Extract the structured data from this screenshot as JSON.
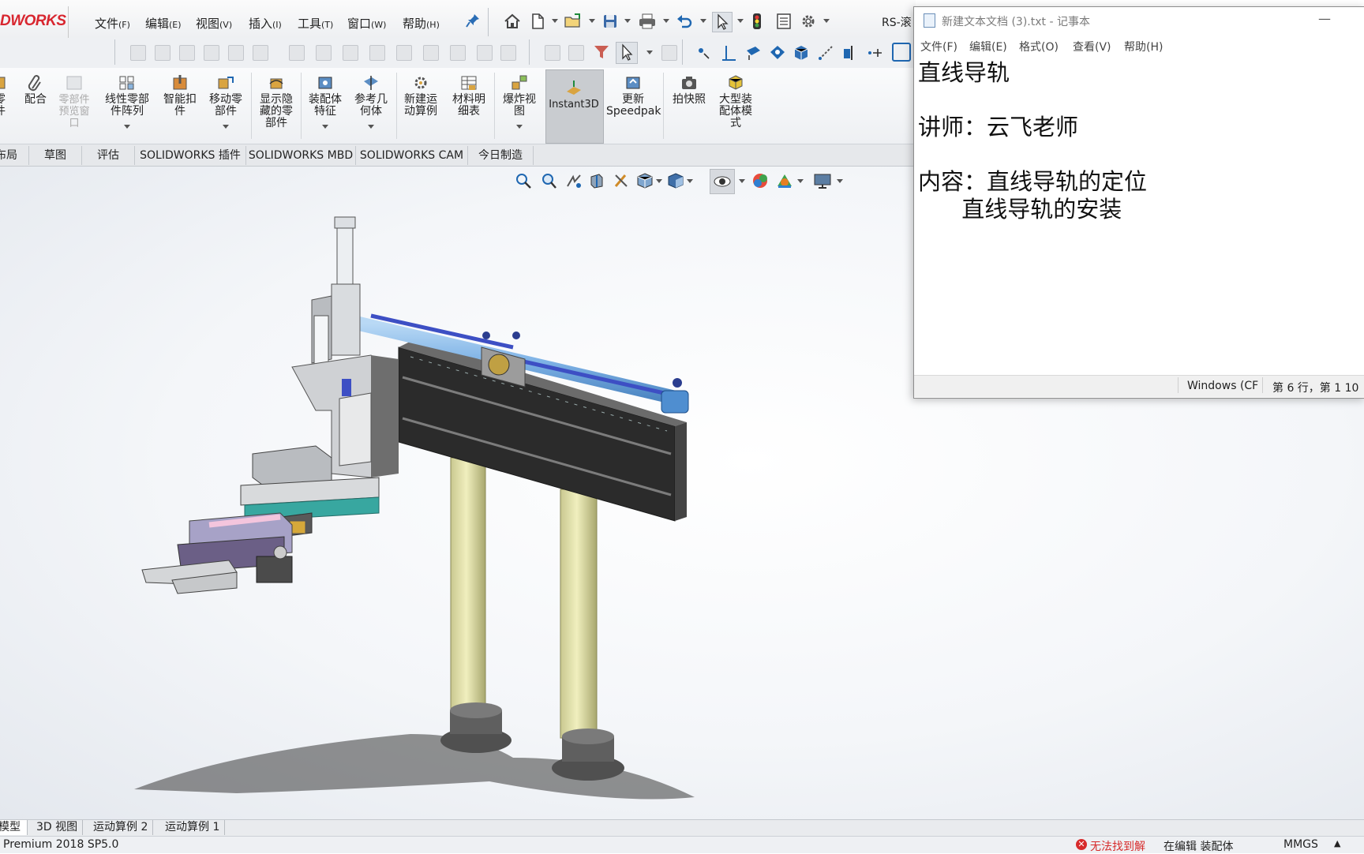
{
  "app": {
    "logo_text": "DWORKS",
    "window_title": "RS-滚",
    "brand_color": "#d8262f"
  },
  "menubar": {
    "items": [
      {
        "label": "文件",
        "key": "(F)"
      },
      {
        "label": "编辑",
        "key": "(E)"
      },
      {
        "label": "视图",
        "key": "(V)"
      },
      {
        "label": "插入",
        "key": "(I)"
      },
      {
        "label": "工具",
        "key": "(T)"
      },
      {
        "label": "窗口",
        "key": "(W)"
      },
      {
        "label": "帮助",
        "key": "(H)"
      }
    ],
    "pin_icon": "pin-icon"
  },
  "quick_access": {
    "icons": [
      "home-icon",
      "new-document-icon",
      "open-folder-icon",
      "save-icon",
      "print-icon",
      "undo-icon",
      "select-arrow-icon",
      "traffic-light-icon",
      "file-properties-icon",
      "options-gear-icon"
    ]
  },
  "command_manager": {
    "buttons": [
      {
        "id": "insert-part",
        "label": "零\n件",
        "icon": "insert-part-icon",
        "enabled": true,
        "caret": false
      },
      {
        "id": "mate",
        "label": "配合",
        "icon": "paperclip-mate-icon",
        "enabled": true,
        "caret": false
      },
      {
        "id": "component-preview",
        "label": "零部件\n预览窗\n口",
        "icon": "component-preview-icon",
        "enabled": false,
        "caret": false
      },
      {
        "id": "linear-pattern",
        "label": "线性零部\n件阵列",
        "icon": "linear-pattern-icon",
        "enabled": true,
        "caret": true
      },
      {
        "id": "smart-fasteners",
        "label": "智能扣\n件",
        "icon": "smart-fastener-icon",
        "enabled": true,
        "caret": false
      },
      {
        "id": "move-component",
        "label": "移动零\n部件",
        "icon": "move-component-icon",
        "enabled": true,
        "caret": true
      },
      {
        "id": "show-hidden",
        "label": "显示隐\n藏的零\n部件",
        "icon": "show-hidden-icon",
        "enabled": true,
        "caret": false
      },
      {
        "id": "assembly-features",
        "label": "装配体\n特征",
        "icon": "assembly-feature-icon",
        "enabled": true,
        "caret": true
      },
      {
        "id": "reference-geometry",
        "label": "参考几\n何体",
        "icon": "reference-geometry-icon",
        "enabled": true,
        "caret": true
      },
      {
        "id": "new-motion-study",
        "label": "新建运\n动算例",
        "icon": "motion-study-icon",
        "enabled": true,
        "caret": false
      },
      {
        "id": "bill-of-materials",
        "label": "材料明\n细表",
        "icon": "bom-table-icon",
        "enabled": true,
        "caret": false
      },
      {
        "id": "exploded-view",
        "label": "爆炸视\n图",
        "icon": "exploded-view-icon",
        "enabled": true,
        "caret": true
      },
      {
        "id": "instant3d",
        "label": "Instant3D",
        "icon": "instant3d-icon",
        "enabled": true,
        "caret": false,
        "active": true
      },
      {
        "id": "update-speedpak",
        "label": "更新\nSpeedpak",
        "icon": "speedpak-icon",
        "enabled": true,
        "caret": false
      },
      {
        "id": "take-snapshot",
        "label": "拍快照",
        "icon": "camera-icon",
        "enabled": true,
        "caret": false
      },
      {
        "id": "large-assembly-mode",
        "label": "大型装\n配体模\n式",
        "icon": "large-assembly-icon",
        "enabled": true,
        "caret": false
      }
    ]
  },
  "tabs": {
    "items": [
      "布局",
      "草图",
      "评估",
      "SOLIDWORKS 插件",
      "SOLIDWORKS MBD",
      "SOLIDWORKS CAM",
      "今日制造"
    ]
  },
  "model_tabs": {
    "items": [
      "模型",
      "3D 视图",
      "运动算例 2",
      "运动算例 1"
    ],
    "active_index": 0
  },
  "statusbar": {
    "version": "Premium 2018 SP5.0",
    "error_text": "无法找到解",
    "editing_text": "在编辑 装配体",
    "units": "MMGS",
    "error_color": "#d72b2b"
  },
  "notepad": {
    "title": "新建文本文档 (3).txt - 记事本",
    "menu": [
      "文件(F)",
      "编辑(E)",
      "格式(O)",
      "查看(V)",
      "帮助(H)"
    ],
    "lines": [
      "直线导轨",
      "",
      "讲师：云飞老师",
      "",
      "内容：直线导轨的定位",
      "      直线导轨的安装"
    ],
    "status_encoding": "Windows (CF",
    "status_position": "第 6 行，第 1 10"
  }
}
